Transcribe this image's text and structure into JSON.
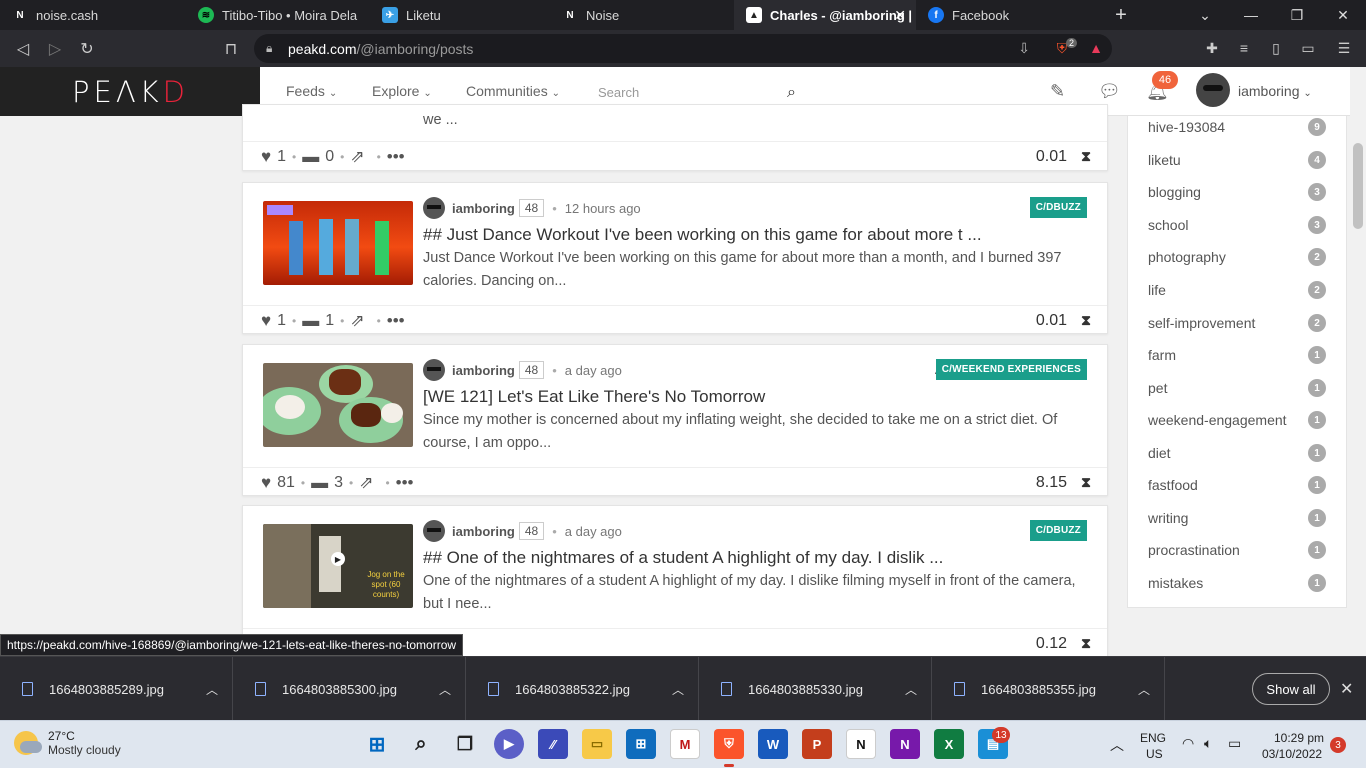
{
  "browser": {
    "tabs": [
      {
        "label": "noise.cash",
        "icon": "noise-icon",
        "active": false
      },
      {
        "label": "Titibo-Tibo • Moira Dela",
        "icon": "spotify-icon",
        "active": false
      },
      {
        "label": "Liketu",
        "icon": "liketu-icon",
        "active": false
      },
      {
        "label": "Noise",
        "icon": "noise-icon",
        "active": false
      },
      {
        "label": "Charles - @iamboring |",
        "icon": "peakd-icon",
        "active": true
      },
      {
        "label": "Facebook",
        "icon": "facebook-icon",
        "active": false
      }
    ],
    "url_host": "peakd.com",
    "url_path": "/@iamboring/posts",
    "brave_count": "2"
  },
  "header": {
    "logo": "PEAKD",
    "nav": [
      "Feeds",
      "Explore",
      "Communities"
    ],
    "search_placeholder": "Search",
    "notifications": "46",
    "username": "iamboring"
  },
  "partial_post": {
    "excerpt": "we ...",
    "likes": "1",
    "comments": "0",
    "payout": "0.01"
  },
  "posts": [
    {
      "author": "iamboring",
      "rep": "48",
      "time": "12 hours ago",
      "community": "C/DBUZZ",
      "title": "## Just Dance Workout I've been working on this game for about more t ...",
      "excerpt": "Just Dance Workout I've been working on this game for about more than a month, and I burned 397 calories. Dancing on...",
      "likes": "1",
      "comments": "1",
      "payout": "0.01"
    },
    {
      "author": "iamboring",
      "rep": "48",
      "time": "a day ago",
      "community": "C/WEEKEND EXPERIENCES",
      "title": "[WE 121] Let's Eat Like There's No Tomorrow",
      "excerpt": "Since my mother is concerned about my inflating weight, she decided to take me on a strict diet. Of course, I am oppo...",
      "likes": "81",
      "comments": "3",
      "payout": "8.15"
    },
    {
      "author": "iamboring",
      "rep": "48",
      "time": "a day ago",
      "community": "C/DBUZZ",
      "title": "## One of the nightmares of a student A highlight of my day. I dislik ...",
      "excerpt": "One of the nightmares of a student A highlight of my day. I dislike filming myself in front of the camera, but I nee...",
      "likes": "",
      "comments": "",
      "payout": "0.12",
      "thumb_caption": "Jog on the spot (60 counts)"
    }
  ],
  "tags": [
    {
      "name": "hive-193084",
      "count": "9"
    },
    {
      "name": "liketu",
      "count": "4"
    },
    {
      "name": "blogging",
      "count": "3"
    },
    {
      "name": "school",
      "count": "3"
    },
    {
      "name": "photography",
      "count": "2"
    },
    {
      "name": "life",
      "count": "2"
    },
    {
      "name": "self-improvement",
      "count": "2"
    },
    {
      "name": "farm",
      "count": "1"
    },
    {
      "name": "pet",
      "count": "1"
    },
    {
      "name": "weekend-engagement",
      "count": "1"
    },
    {
      "name": "diet",
      "count": "1"
    },
    {
      "name": "fastfood",
      "count": "1"
    },
    {
      "name": "writing",
      "count": "1"
    },
    {
      "name": "procrastination",
      "count": "1"
    },
    {
      "name": "mistakes",
      "count": "1"
    }
  ],
  "status_url": "https://peakd.com/hive-168869/@iamboring/we-121-lets-eat-like-theres-no-tomorrow",
  "downloads": [
    "1664803885289.jpg",
    "1664803885300.jpg",
    "1664803885322.jpg",
    "1664803885330.jpg",
    "1664803885355.jpg"
  ],
  "show_all": "Show all",
  "taskbar": {
    "temp": "27°C",
    "weather": "Mostly cloudy",
    "lang1": "ENG",
    "lang2": "US",
    "time": "10:29 pm",
    "date": "03/10/2022",
    "notif": "3",
    "app_badge": "13"
  }
}
